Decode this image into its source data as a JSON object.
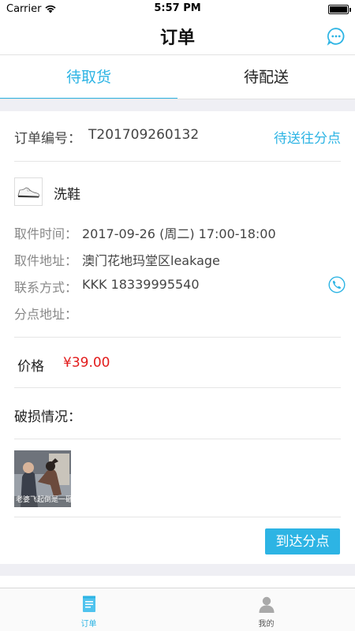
{
  "status_bar": {
    "carrier": "Carrier",
    "time": "5:57 PM",
    "battery_percent": 100
  },
  "nav": {
    "title": "订单",
    "chat_icon": "chat-bubble-icon"
  },
  "tabs": [
    {
      "label": "待取货",
      "active": true
    },
    {
      "label": "待配送",
      "active": false
    }
  ],
  "order": {
    "number_label": "订单编号：",
    "number_value": "T201709260132",
    "status": "待送往分点",
    "product": {
      "name": "洗鞋",
      "thumb_icon": "sneaker-icon"
    },
    "info": [
      {
        "label": "取件时间：",
        "value": "2017-09-26 (周二) 17:00-18:00"
      },
      {
        "label": "取件地址：",
        "value": "澳门花地玛堂区leakage"
      },
      {
        "label": "联系方式：",
        "value": "KKK  18339995540"
      },
      {
        "label": "分点地址：",
        "value": ""
      }
    ],
    "price_label": "价格",
    "price_value": "¥39.00",
    "damage_label": "破损情况：",
    "damage_photo_caption": "老婆飞起倒是一砸",
    "action_button": "到达分点"
  },
  "tab_bar": [
    {
      "label": "订单",
      "icon": "order-list-icon",
      "active": true
    },
    {
      "label": "我的",
      "icon": "user-icon",
      "active": false
    }
  ],
  "colors": {
    "accent": "#2db4e4",
    "price": "#e21b1b",
    "background_gap": "#efeff4"
  }
}
